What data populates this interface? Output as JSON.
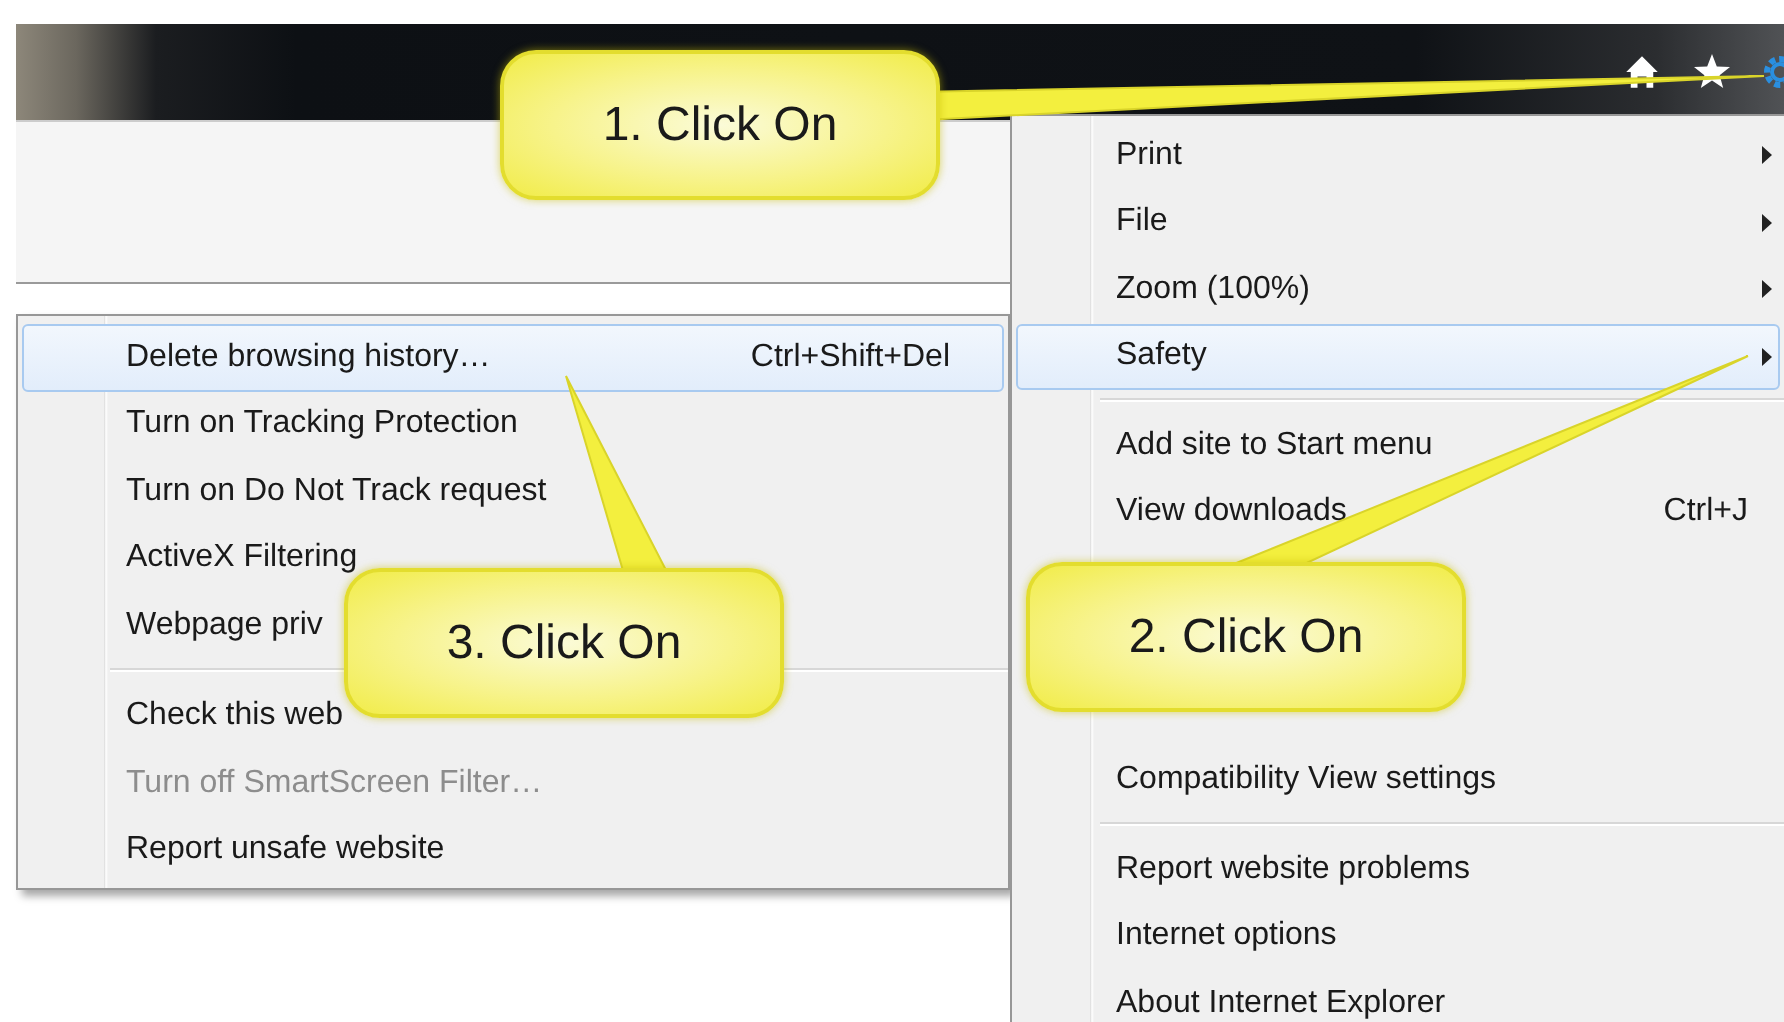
{
  "menu": {
    "items": [
      {
        "kind": "item",
        "label": "Print",
        "has_submenu": true,
        "selected": false
      },
      {
        "kind": "item",
        "label": "File",
        "has_submenu": true,
        "selected": false
      },
      {
        "kind": "item",
        "label": "Zoom (100%)",
        "has_submenu": true,
        "selected": false
      },
      {
        "kind": "item",
        "label": "Safety",
        "has_submenu": true,
        "selected": true
      },
      {
        "kind": "separator"
      },
      {
        "kind": "item",
        "label": "Add site to Start menu",
        "has_submenu": false,
        "selected": false
      },
      {
        "kind": "item",
        "label": "View downloads",
        "shortcut": "Ctrl+J",
        "has_submenu": false,
        "selected": false
      },
      {
        "kind": "covered"
      },
      {
        "kind": "covered"
      },
      {
        "kind": "covered"
      },
      {
        "kind": "item",
        "label": "Compatibility View settings",
        "has_submenu": false,
        "selected": false
      },
      {
        "kind": "separator"
      },
      {
        "kind": "item",
        "label": "Report website problems",
        "has_submenu": false,
        "selected": false
      },
      {
        "kind": "item",
        "label": "Internet options",
        "has_submenu": false,
        "selected": false
      },
      {
        "kind": "item",
        "label": "About Internet Explorer",
        "has_submenu": false,
        "selected": false
      }
    ]
  },
  "submenu": {
    "items": [
      {
        "kind": "item",
        "label": "Delete browsing history…",
        "shortcut": "Ctrl+Shift+Del",
        "selected": true,
        "disabled": false
      },
      {
        "kind": "item",
        "label": "Turn on Tracking Protection",
        "selected": false,
        "disabled": false
      },
      {
        "kind": "item",
        "label": "Turn on Do Not Track request",
        "selected": false,
        "disabled": false
      },
      {
        "kind": "item",
        "label": "ActiveX Filtering",
        "selected": false,
        "disabled": false
      },
      {
        "kind": "item",
        "label": "Webpage priv",
        "selected": false,
        "disabled": false
      },
      {
        "kind": "separator"
      },
      {
        "kind": "item",
        "label": "Check this web",
        "selected": false,
        "disabled": false
      },
      {
        "kind": "item",
        "label": "Turn off SmartScreen Filter…",
        "selected": false,
        "disabled": true
      },
      {
        "kind": "item",
        "label": "Report unsafe website",
        "selected": false,
        "disabled": false
      }
    ]
  },
  "callouts": [
    {
      "text": "1. Click On"
    },
    {
      "text": "2. Click On"
    },
    {
      "text": "3. Click On"
    }
  ]
}
